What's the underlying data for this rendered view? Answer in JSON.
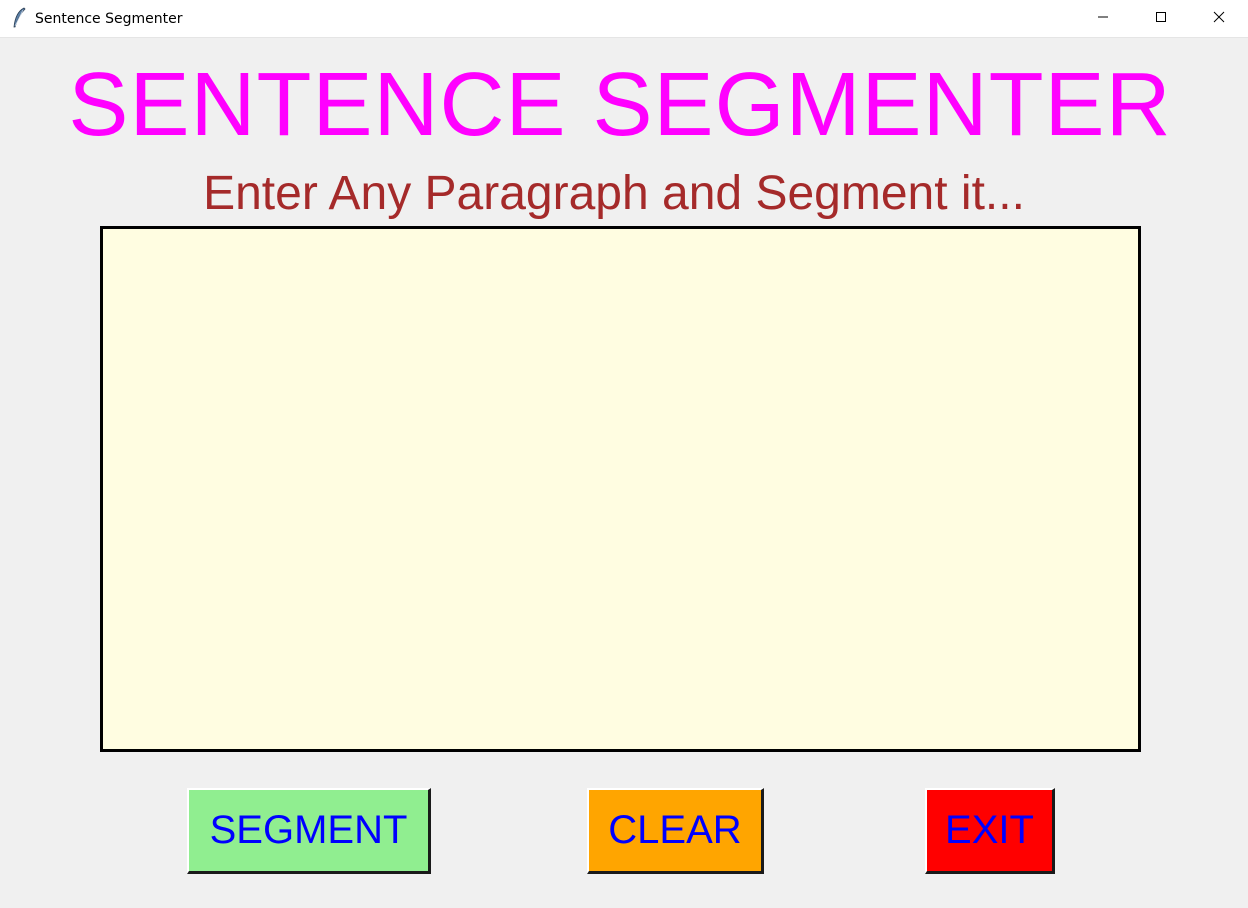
{
  "window": {
    "title": "Sentence Segmenter",
    "icon": "feather-icon",
    "controls": [
      "minimize-icon",
      "maximize-icon",
      "close-icon"
    ]
  },
  "main": {
    "heading": "SENTENCE SEGMENTER",
    "subheading": "Enter Any Paragraph and Segment it...",
    "input": {
      "value": "",
      "placeholder": ""
    }
  },
  "buttons": {
    "segment_label": "SEGMENT",
    "clear_label": "CLEAR",
    "exit_label": "EXIT"
  },
  "colors": {
    "heading": "#ff00ff",
    "subheading": "#a52a2a",
    "input_background": "#fffde1",
    "segment_button": "#90ee90",
    "clear_button": "#ffa500",
    "exit_button": "#ff0000",
    "button_text": "#0000ff"
  }
}
